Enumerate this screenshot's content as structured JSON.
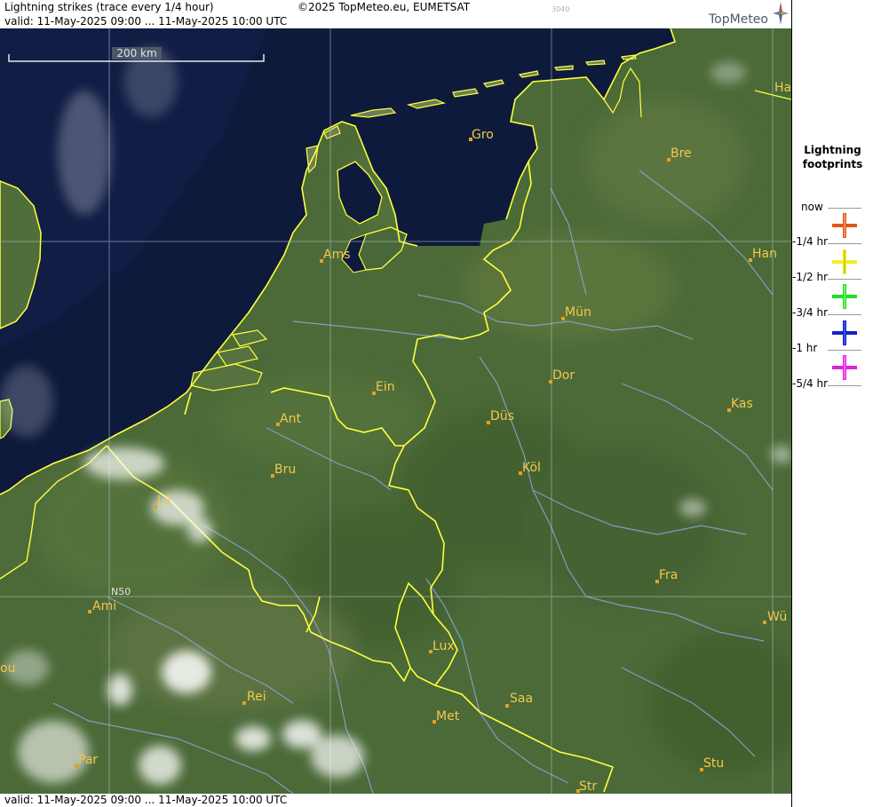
{
  "header": {
    "title": "Lightning strikes (trace every 1/4 hour)",
    "valid": "valid:  11-May-2025 09:00 ... 11-May-2025 10:00 UTC",
    "copyright": "©2025 TopMeteo.eu, EUMETSAT",
    "code": "3040",
    "brand": "TopMeteo"
  },
  "footer": {
    "valid": "valid:  11-May-2025 09:00 ... 11-May-2025 10:00 UTC"
  },
  "map": {
    "scale_label": "200 km",
    "latitude_label": "N50",
    "colors": {
      "sea": "#0e1a3c",
      "land": "#4b6a38",
      "border": "#ffff40",
      "city_marker": "#e8a020",
      "city_label": "#f2c94c",
      "grid": "#b8c4cc",
      "river": "#8fa4d8"
    },
    "cities": [
      {
        "label": "Gro"
      },
      {
        "label": "Bre"
      },
      {
        "label": "Ha"
      },
      {
        "label": "Ams"
      },
      {
        "label": "Han"
      },
      {
        "label": "Mün"
      },
      {
        "label": "Dor"
      },
      {
        "label": "Ein"
      },
      {
        "label": "Ant"
      },
      {
        "label": "Düs"
      },
      {
        "label": "Kas"
      },
      {
        "label": "Bru"
      },
      {
        "label": "Köl"
      },
      {
        "label": "Lil"
      },
      {
        "label": "Fra"
      },
      {
        "label": "Ami"
      },
      {
        "label": "Wü"
      },
      {
        "label": "Lux"
      },
      {
        "label": "ou"
      },
      {
        "label": "Rei"
      },
      {
        "label": "Saa"
      },
      {
        "label": "Met"
      },
      {
        "label": "Par"
      },
      {
        "label": "Stu"
      },
      {
        "label": "Str"
      }
    ]
  },
  "legend": {
    "title_line1": "Lightning",
    "title_line2": "footprints",
    "entries": [
      {
        "label": "now",
        "color": "#e05818"
      },
      {
        "label": "-1/4 hr",
        "color": "#f0f020"
      },
      {
        "label": "-1/2 hr",
        "color": "#20e020"
      },
      {
        "label": "-3/4 hr",
        "color": "#1020c8"
      },
      {
        "label": "-1 hr",
        "color": "#e020e0"
      },
      {
        "label": "-5/4 hr"
      }
    ]
  }
}
